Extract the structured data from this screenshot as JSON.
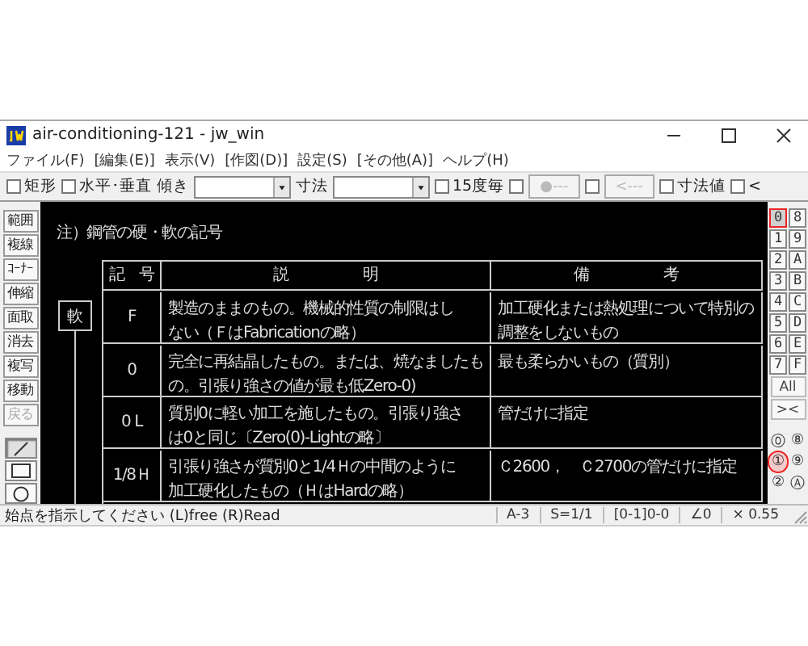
{
  "window": {
    "title": "air-conditioning-121 - jw_win"
  },
  "menu": [
    "ファイル(F)",
    "[編集(E)]",
    "表示(V)",
    "[作図(D)]",
    "設定(S)",
    "[その他(A)]",
    "ヘルプ(H)"
  ],
  "toolbar": [
    {
      "kind": "checkbox",
      "label": "矩形",
      "checked": false
    },
    {
      "kind": "checkbox",
      "label": "水平･垂直",
      "checked": false
    },
    {
      "kind": "label",
      "label": "傾き"
    },
    {
      "kind": "combo"
    },
    {
      "kind": "label",
      "label": "寸法"
    },
    {
      "kind": "combo"
    },
    {
      "kind": "checkbox",
      "label": "15度毎",
      "checked": false
    },
    {
      "kind": "checkbox",
      "checked": false
    },
    {
      "kind": "button",
      "label": "●---",
      "disabled": true
    },
    {
      "kind": "checkbox",
      "checked": false
    },
    {
      "kind": "button",
      "label": "<---",
      "disabled": true
    },
    {
      "kind": "checkbox",
      "label": "寸法値",
      "checked": false
    },
    {
      "kind": "checkbox",
      "label": "<",
      "checked": false
    }
  ],
  "commands": [
    {
      "label": "範囲",
      "disabled": false
    },
    {
      "label": "複線",
      "disabled": false
    },
    {
      "label": "ｺｰﾅｰ",
      "disabled": false
    },
    {
      "label": "伸縮",
      "disabled": false
    },
    {
      "label": "面取",
      "disabled": false
    },
    {
      "label": "消去",
      "disabled": false
    },
    {
      "label": "複写",
      "disabled": false
    },
    {
      "label": "移動",
      "disabled": false
    },
    {
      "label": "戻る",
      "disabled": true
    }
  ],
  "draw_tools": [
    {
      "kind": "line",
      "selected": true
    },
    {
      "kind": "rect",
      "selected": false
    },
    {
      "kind": "circle",
      "selected": false
    }
  ],
  "canvas": {
    "note": "注）鋼管の硬・軟の記号",
    "side_label": "軟",
    "columns": [
      "記　号",
      "説　　　　　明",
      "備　　　　　考"
    ],
    "rows": [
      {
        "symbol": "F",
        "description": [
          "製造のままのもの。機械的性質の制限はし",
          "ない（ＦはFabricationの略）"
        ],
        "remarks": [
          "加工硬化または熱処理について特別の",
          "調整をしないもの"
        ]
      },
      {
        "symbol": "0",
        "description": [
          "完全に再結晶したもの。または、焼なましたも",
          "の。引張り強さの値が最も低Zero-0)"
        ],
        "remarks": [
          "最も柔らかいもの（質別）"
        ]
      },
      {
        "symbol": "0 L",
        "description": [
          "質別0に軽い加工を施したもの。引張り強さ",
          "は0と同じ〔Zero(0)-Lightの略〕"
        ],
        "remarks": [
          "管だけに指定"
        ]
      },
      {
        "symbol": "1/8Ｈ",
        "description": [
          "引張り強さが質別0と1/4Ｈの中間のように",
          "加工硬化したもの（ＨはHardの略）"
        ],
        "remarks": [
          "Ｃ2600，　Ｃ2700の管だけに指定"
        ]
      }
    ]
  },
  "layers": [
    {
      "label": "0",
      "selected": true
    },
    {
      "label": "8",
      "selected": false
    },
    {
      "label": "1",
      "selected": false
    },
    {
      "label": "9",
      "selected": false
    },
    {
      "label": "2",
      "selected": false
    },
    {
      "label": "A",
      "selected": false
    },
    {
      "label": "3",
      "selected": false
    },
    {
      "label": "B",
      "selected": false
    },
    {
      "label": "4",
      "selected": false
    },
    {
      "label": "C",
      "selected": false
    },
    {
      "label": "5",
      "selected": false
    },
    {
      "label": "D",
      "selected": false
    },
    {
      "label": "6",
      "selected": false
    },
    {
      "label": "E",
      "selected": false
    },
    {
      "label": "7",
      "selected": false
    },
    {
      "label": "F",
      "selected": false
    }
  ],
  "layer_buttons": [
    "All",
    "><"
  ],
  "groups": [
    {
      "label": "⓪",
      "selected": false
    },
    {
      "label": "⑧",
      "selected": false
    },
    {
      "label": "①",
      "selected": true
    },
    {
      "label": "⑨",
      "selected": false
    },
    {
      "label": "②",
      "selected": false
    },
    {
      "label": "Ⓐ",
      "selected": false
    }
  ],
  "status_bar": {
    "message": "始点を指示してください (L)free (R)Read",
    "cells": [
      "A-3",
      "S=1/1",
      "[0-1]0-0",
      "∠0",
      "× 0.55"
    ]
  }
}
